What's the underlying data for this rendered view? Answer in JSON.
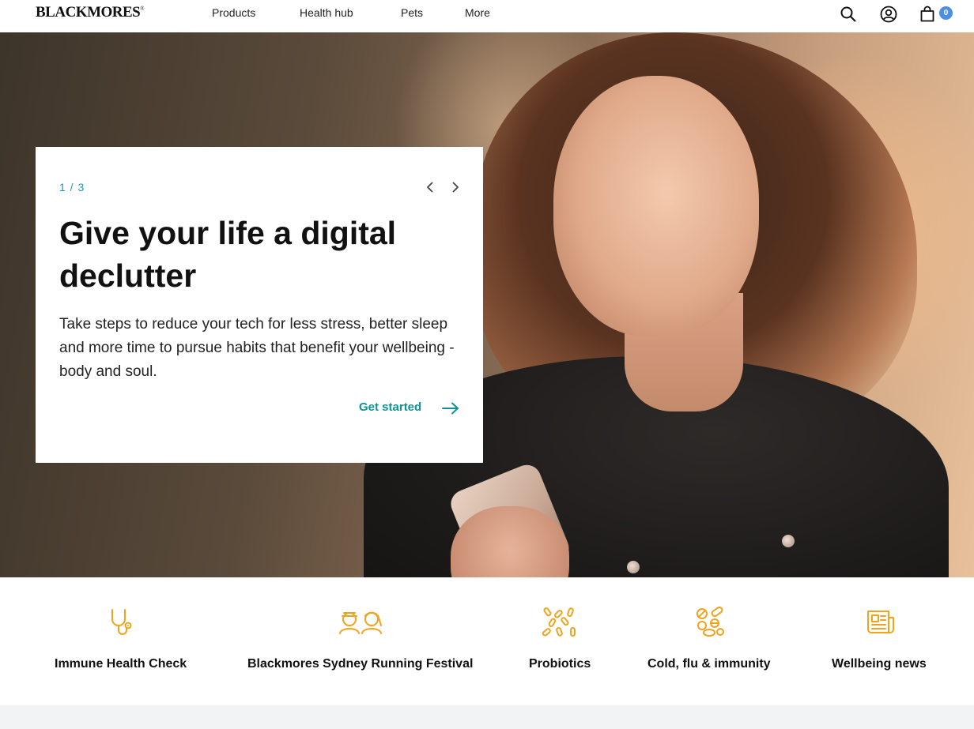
{
  "brand": {
    "logo": "BLACKMORES",
    "logo_mark": "®"
  },
  "nav": {
    "items": [
      {
        "label": "Products"
      },
      {
        "label": "Health hub"
      },
      {
        "label": "Pets"
      },
      {
        "label": "More"
      }
    ]
  },
  "header_icons": {
    "search": "search-icon",
    "account": "user-icon",
    "cart": "shopping-bag-icon",
    "cart_count": "0"
  },
  "hero": {
    "counter": "1 / 3",
    "title": "Give your life a digital declutter",
    "body": "Take steps to reduce your tech for less stress, better sleep and more time to pursue habits that benefit your wellbeing - body and soul.",
    "cta": "Get started",
    "slides_total": 3,
    "active_slide": 1
  },
  "quick_links": [
    {
      "label": "Immune Health Check",
      "icon": "stethoscope-icon"
    },
    {
      "label": "Blackmores Sydney Running Festival",
      "icon": "runners-icon"
    },
    {
      "label": "Probiotics",
      "icon": "probiotics-icon"
    },
    {
      "label": "Cold, flu & immunity",
      "icon": "pills-icon"
    },
    {
      "label": "Wellbeing news",
      "icon": "newspaper-icon"
    }
  ],
  "colors": {
    "accent": "#0f9295",
    "counter": "#1a9aa8",
    "icons": "#f2a21b",
    "badge": "#4c8ee6"
  }
}
